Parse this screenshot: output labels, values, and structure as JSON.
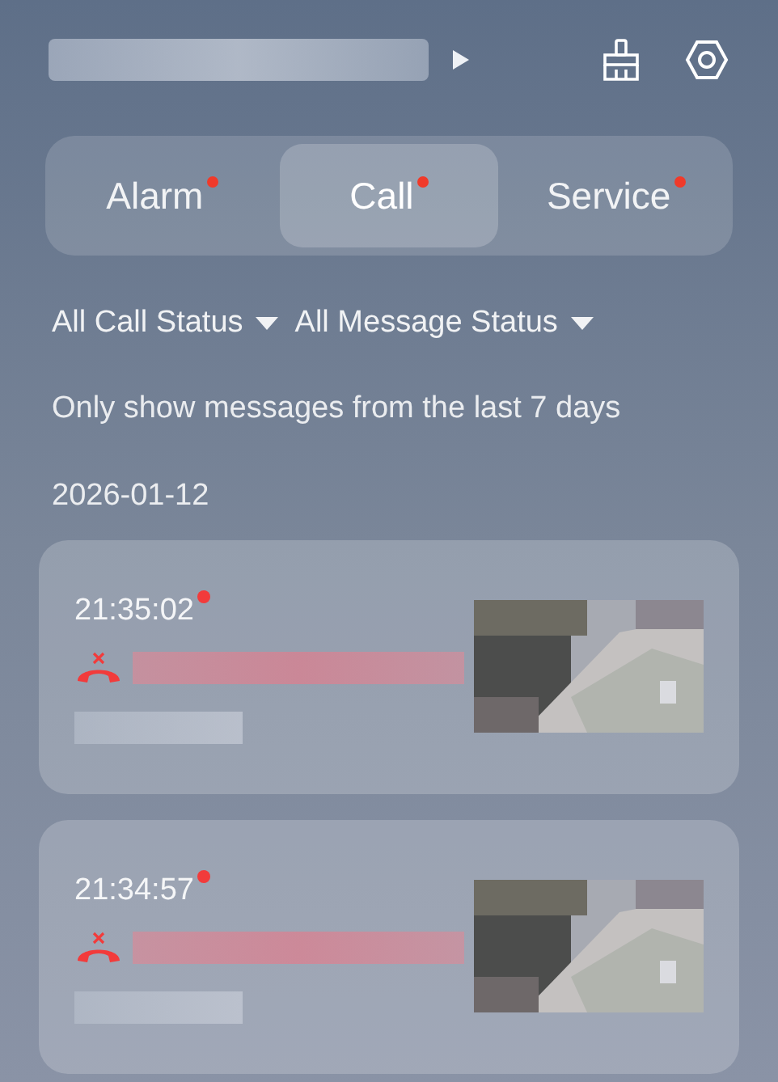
{
  "tabs": [
    {
      "label": "Alarm",
      "selected": false,
      "unread": true
    },
    {
      "label": "Call",
      "selected": true,
      "unread": true
    },
    {
      "label": "Service",
      "selected": false,
      "unread": true
    }
  ],
  "filters": [
    {
      "label": "All Call Status"
    },
    {
      "label": "All Message Status"
    }
  ],
  "note": "Only show messages from the last 7 days",
  "groups": [
    {
      "date": "2026-01-12",
      "calls": [
        {
          "time": "21:35:02",
          "unread": true,
          "kind": "declined"
        },
        {
          "time": "21:34:57",
          "unread": true,
          "kind": "declined"
        }
      ]
    }
  ]
}
